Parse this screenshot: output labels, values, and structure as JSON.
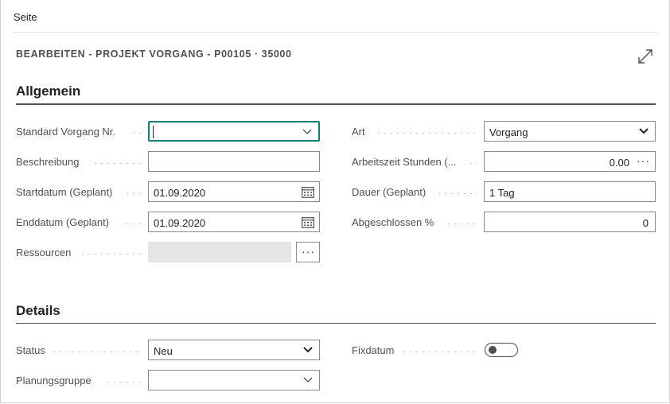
{
  "header": {
    "breadcrumb": "Seite"
  },
  "page_title": "BEARBEITEN - PROJEKT VORGANG - P00105 · 35000",
  "sections": {
    "general": {
      "title": "Allgemein"
    },
    "details": {
      "title": "Details"
    }
  },
  "fields": {
    "standard_task_no": {
      "label": "Standard Vorgang Nr.",
      "value": ""
    },
    "description": {
      "label": "Beschreibung",
      "value": ""
    },
    "start_date": {
      "label": "Startdatum (Geplant)",
      "value": "01.09.2020"
    },
    "end_date": {
      "label": "Enddatum (Geplant)",
      "value": "01.09.2020"
    },
    "resources": {
      "label": "Ressourcen",
      "value": ""
    },
    "type": {
      "label": "Art",
      "value": "Vorgang"
    },
    "work_hours": {
      "label": "Arbeitszeit Stunden (...",
      "value": "0.00"
    },
    "duration": {
      "label": "Dauer (Geplant)",
      "value": "1 Tag"
    },
    "completed_pct": {
      "label": "Abgeschlossen %",
      "value": "0"
    },
    "status": {
      "label": "Status",
      "value": "Neu"
    },
    "planning_group": {
      "label": "Planungsgruppe",
      "value": ""
    },
    "fixed_date": {
      "label": "Fixdatum",
      "value": false
    }
  }
}
